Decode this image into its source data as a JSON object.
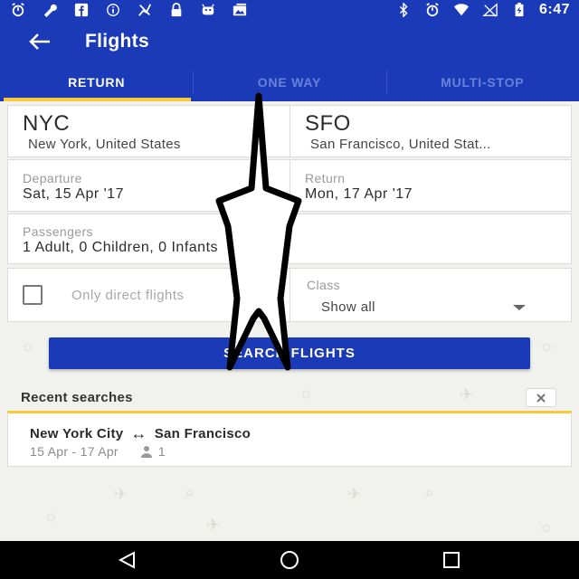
{
  "status_bar": {
    "time": "6:47",
    "left_icons": [
      "alarm-icon",
      "wrench-icon",
      "facebook-icon",
      "info-icon",
      "ban-icon",
      "lock-icon",
      "android-icon",
      "photo-icon"
    ],
    "right_icons": [
      "bluetooth-icon",
      "alarm-icon",
      "wifi-icon",
      "no-signal-icon",
      "battery-icon"
    ]
  },
  "app_bar": {
    "title": "Flights",
    "back_icon": "back-arrow-icon"
  },
  "tabs": [
    {
      "label": "RETURN",
      "active": true
    },
    {
      "label": "ONE WAY",
      "active": false
    },
    {
      "label": "MULTI-STOP",
      "active": false
    }
  ],
  "origin": {
    "code": "NYC",
    "city": "New York, United States"
  },
  "destination": {
    "code": "SFO",
    "city": "San Francisco, United Stat..."
  },
  "departure": {
    "label": "Departure",
    "value": "Sat, 15 Apr '17"
  },
  "return_date": {
    "label": "Return",
    "value": "Mon, 17 Apr '17"
  },
  "passengers": {
    "label": "Passengers",
    "value": "1 Adult, 0 Children, 0 Infants"
  },
  "direct_flights": {
    "label": "Only direct flights",
    "checked": false
  },
  "class_select": {
    "label": "Class",
    "value": "Show all"
  },
  "search_button": {
    "label": "SEARCH FLIGHTS"
  },
  "recent": {
    "title": "Recent searches",
    "clear_icon": "close-icon",
    "items": [
      {
        "from": "New York City",
        "arrow": "↔",
        "to": "San Francisco",
        "dates": "15 Apr - 17 Apr",
        "passengers": "1"
      }
    ]
  },
  "nav_bar": {
    "icons": [
      "back-icon",
      "home-icon",
      "recents-icon"
    ]
  },
  "colors": {
    "primary": "#1b3ab8",
    "accent": "#f7c93b",
    "background": "#f1f1ee"
  }
}
